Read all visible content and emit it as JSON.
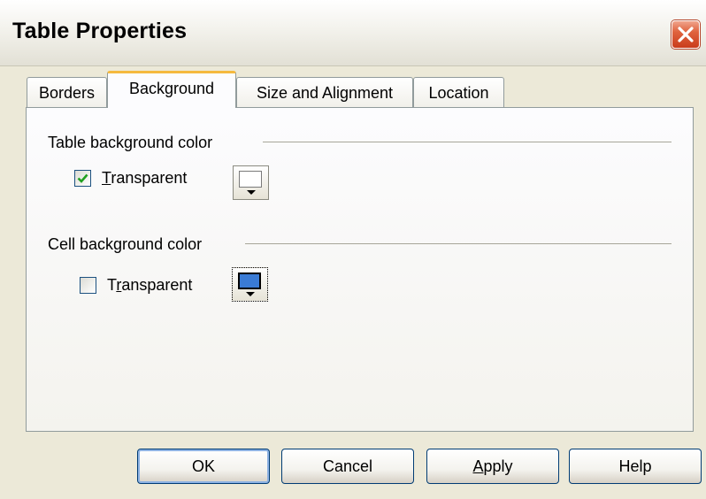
{
  "window": {
    "title": "Table Properties"
  },
  "titlebar": {
    "close_icon": "close-icon"
  },
  "tabs": [
    {
      "label": "Borders",
      "selected": false
    },
    {
      "label": "Background",
      "selected": true
    },
    {
      "label": "Size and Alignment",
      "selected": false
    },
    {
      "label": "Location",
      "selected": false
    }
  ],
  "table_background": {
    "group_label": "Table background color",
    "transparent_checked": true,
    "transparent_mnemonic": "T",
    "transparent_rest": "ransparent",
    "color_button_icon": "color-picker-icon",
    "swatch_color": "#ffffff"
  },
  "cell_background": {
    "group_label": "Cell background color",
    "transparent_checked": false,
    "transparent_prefix": "T",
    "transparent_mnemonic": "r",
    "transparent_rest": "ansparent",
    "color_button_icon": "color-picker-icon",
    "swatch_color": "#3a7bd5"
  },
  "buttons": {
    "ok": "OK",
    "cancel": "Cancel",
    "apply_mnemonic": "A",
    "apply_rest": "pply",
    "help": "Help"
  },
  "colors": {
    "dialog_bg": "#ece9d8",
    "tab_highlight": "#f5b93f",
    "close_red": "#e0633e",
    "check_green": "#21a121"
  }
}
